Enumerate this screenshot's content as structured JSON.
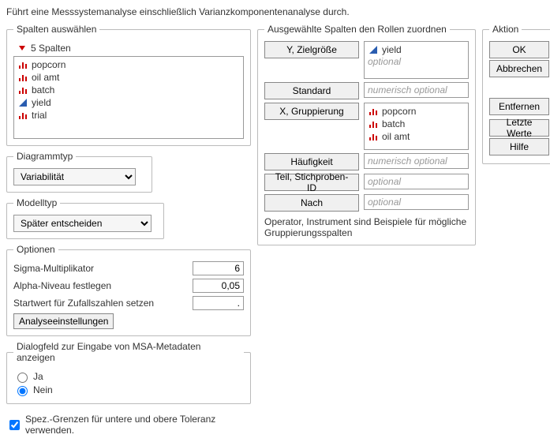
{
  "description": "Führt eine Messsystemanalyse einschließlich Varianzkomponentenanalyse durch.",
  "columns": {
    "legend": "Spalten auswählen",
    "count_label": "5 Spalten",
    "items": [
      {
        "name": "popcorn",
        "icon": "bars-red"
      },
      {
        "name": "oil amt",
        "icon": "bars-red"
      },
      {
        "name": "batch",
        "icon": "bars-red"
      },
      {
        "name": "yield",
        "icon": "tri-blue"
      },
      {
        "name": "trial",
        "icon": "bars-red"
      }
    ]
  },
  "chart_type": {
    "legend": "Diagrammtyp",
    "value": "Variabilität"
  },
  "model_type": {
    "legend": "Modelltyp",
    "value": "Später entscheiden"
  },
  "options": {
    "legend": "Optionen",
    "sigma_label": "Sigma-Multiplikator",
    "sigma_value": "6",
    "alpha_label": "Alpha-Niveau festlegen",
    "alpha_value": "0,05",
    "seed_label": "Startwert für Zufallszahlen setzen",
    "seed_value": ".",
    "settings_button": "Analyseeinstellungen"
  },
  "meta_dialog": {
    "legend": "Dialogfeld zur Eingabe von MSA-Metadaten anzeigen",
    "yes": "Ja",
    "no": "Nein",
    "value": "Nein"
  },
  "spec_check": {
    "label": "Spez.-Grenzen für untere und obere Toleranz verwenden.",
    "checked": true
  },
  "roles": {
    "legend": "Ausgewählte Spalten den Rollen zuordnen",
    "y_button": "Y, Zielgröße",
    "y_items": [
      {
        "name": "yield",
        "icon": "tri-blue"
      }
    ],
    "y_placeholder": "optional",
    "standard_button": "Standard",
    "standard_placeholder": "numerisch optional",
    "x_button": "X, Gruppierung",
    "x_items": [
      {
        "name": "popcorn",
        "icon": "bars-red"
      },
      {
        "name": "batch",
        "icon": "bars-red"
      },
      {
        "name": "oil amt",
        "icon": "bars-red"
      }
    ],
    "freq_button": "Häufigkeit",
    "freq_placeholder": "numerisch optional",
    "part_button": "Teil, Stichproben-ID",
    "part_placeholder": "optional",
    "by_button": "Nach",
    "by_placeholder": "optional",
    "hint": "Operator, Instrument sind Beispiele für mögliche Gruppierungsspalten"
  },
  "actions": {
    "legend": "Aktion",
    "ok": "OK",
    "cancel": "Abbrechen",
    "remove": "Entfernen",
    "recall": "Letzte Werte",
    "help": "Hilfe"
  }
}
